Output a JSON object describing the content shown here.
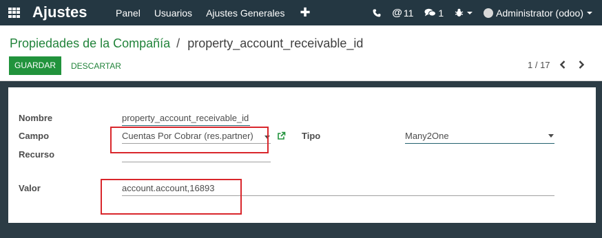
{
  "navbar": {
    "app_title": "Ajustes",
    "menu": [
      "Panel",
      "Usuarios",
      "Ajustes Generales"
    ],
    "plus_label": "✚",
    "mentions_count": "11",
    "messages_count": "1",
    "user": "Administrator (odoo)"
  },
  "breadcrumb": {
    "parent": "Propiedades de la Compañía",
    "separator": "/",
    "current": "property_account_receivable_id"
  },
  "buttons": {
    "save": "GUARDAR",
    "discard": "DESCARTAR"
  },
  "pager": {
    "value": "1 / 17"
  },
  "form": {
    "name_label": "Nombre",
    "name_value": "property_account_receivable_id",
    "field_label": "Campo",
    "field_value": "Cuentas Por Cobrar (res.partner)",
    "type_label": "Tipo",
    "type_value": "Many2One",
    "resource_label": "Recurso",
    "resource_value": "",
    "value_label": "Valor",
    "value_value": "account.account,16893"
  },
  "colors": {
    "navbar": "#243742",
    "primary": "#21933c",
    "link": "#21833a",
    "form_background": "#2c3c45",
    "highlight": "#d9262b"
  }
}
